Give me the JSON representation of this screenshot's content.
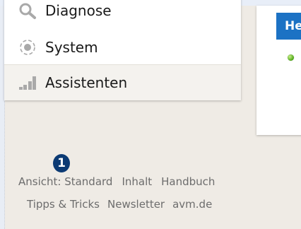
{
  "menu": {
    "items": [
      {
        "label": "Diagnose",
        "icon": "diagnose-icon"
      },
      {
        "label": "System",
        "icon": "system-icon"
      },
      {
        "label": "Assistenten",
        "icon": "assistenten-icon",
        "active": true
      }
    ]
  },
  "panel": {
    "header_label": "He",
    "status_color": "#4aa413"
  },
  "marker": {
    "number": "1",
    "color": "#0c3a73"
  },
  "footer": {
    "line1": [
      "Ansicht: Standard",
      "Inhalt",
      "Handbuch"
    ],
    "line2": [
      "Tipps & Tricks",
      "Newsletter",
      "avm.de"
    ]
  },
  "colors": {
    "accent": "#1c72c4",
    "background": "#efebe5"
  }
}
